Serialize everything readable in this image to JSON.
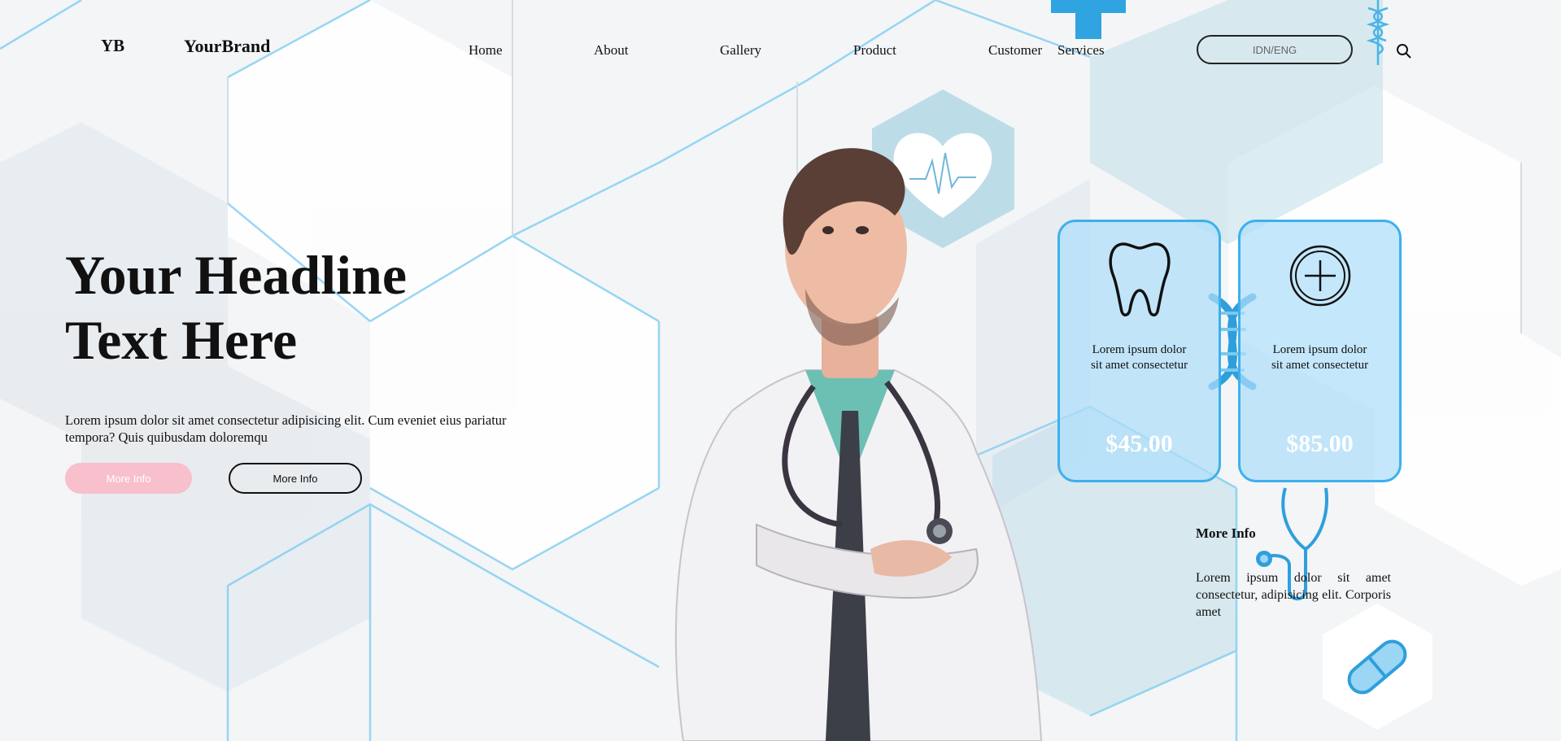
{
  "brand": {
    "mark": "YB",
    "name": "YourBrand"
  },
  "nav": [
    "Home",
    "About",
    "Gallery",
    "Product",
    "Customer",
    "Services"
  ],
  "language_toggle": "IDN/ENG",
  "hero": {
    "headline_line1": "Your Headline",
    "headline_line2": "Text Here",
    "subtext_line1": "Lorem ipsum dolor sit amet consectetur adipisicing elit. Cum eveniet eius pariatur",
    "subtext_line2": "tempora? Quis quibusdam doloremqu",
    "primary_button": "More Info",
    "secondary_button": "More Info"
  },
  "cards": [
    {
      "icon": "tooth-icon",
      "desc_line1": "Lorem ipsum dolor",
      "desc_line2": "sit amet consectetur",
      "price": "$45.00"
    },
    {
      "icon": "medical-cross-icon",
      "desc_line1": "Lorem ipsum dolor",
      "desc_line2": "sit amet consectetur",
      "price": "$85.00"
    }
  ],
  "info": {
    "title": "More Info",
    "body": "Lorem ipsum dolor sit amet consectetur, adipisicing elit. Corporis amet"
  },
  "colors": {
    "accent_blue": "#3db0ec",
    "pink": "#f8bfcc",
    "card_fill": "#addefa"
  },
  "decor_icons": [
    "hexagon-pattern",
    "medical-cross-icon",
    "caduceus-icon",
    "heartbeat-icon",
    "dna-icon",
    "stethoscope-icon",
    "pill-icon",
    "doctor-illustration"
  ]
}
